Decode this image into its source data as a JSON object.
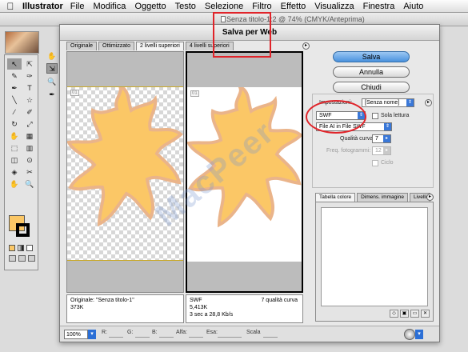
{
  "menubar": {
    "apple_icon": "apple-icon",
    "app_name": "Illustrator",
    "items": [
      "File",
      "Modifica",
      "Oggetto",
      "Testo",
      "Selezione",
      "Filtro",
      "Effetto",
      "Visualizza",
      "Finestra",
      "Aiuto"
    ]
  },
  "document": {
    "title": "Senza titolo-1:2 @ 74% (CMYK/Anteprima)"
  },
  "tools_palette": {
    "tools": [
      "↖",
      "⇱",
      "✎",
      "✑",
      "✒",
      "T",
      "╲",
      "☆",
      "∕",
      "✐",
      "↻",
      "⤢",
      "✋",
      "▦",
      "⬚",
      "▥",
      "◫",
      "⊙",
      "◈",
      "✂",
      "✋",
      "🔍"
    ],
    "fill_color": "#fbc766",
    "stroke_color": "#000000"
  },
  "dialog": {
    "title": "Salva per Web",
    "tabs": [
      "Originale",
      "Ottimizzato",
      "2 livelli superiori",
      "4 livelli superiori"
    ],
    "active_tab": "2 livelli superiori",
    "left_tools": [
      "✋",
      "⇲",
      "🔍",
      "✒"
    ],
    "original_info": {
      "line1": "Originale: \"Senza titolo-1\"",
      "line2": "373K"
    },
    "optimized_info": {
      "format": "SWF",
      "size": "5,413K",
      "time": "3 sec a 28,8 Kb/s",
      "quality": "7 qualità curva"
    },
    "buttons": {
      "save": "Salva",
      "cancel": "Annulla",
      "close": "Chiudi"
    },
    "settings": {
      "label": "Impostazioni:",
      "preset": "[Senza nome]",
      "format": "SWF",
      "read_only_label": "Sola lettura",
      "ai_file_option": "File AI in File SWF",
      "curve_quality_label": "Qualità curva:",
      "curve_quality_value": "7",
      "frame_rate_label": "Freq. fotogrammi:",
      "frame_rate_value": "12",
      "loop_label": "Ciclo"
    },
    "color_panel_tabs": [
      "Tabella colore",
      "Dimens. immagine",
      "Livelli"
    ],
    "status_bar": {
      "zoom": "100%",
      "r_label": "R:",
      "g_label": "G:",
      "b_label": "B:",
      "alpha_label": "Alfa:",
      "hex_label": "Esa:",
      "index_label": "Scala"
    }
  },
  "watermark": "MacPeer",
  "colors": {
    "artwork_fill": "#fbc766",
    "artwork_edge": "#eab48a",
    "annotation": "#e0242a",
    "primary_button": "#4a92de"
  }
}
